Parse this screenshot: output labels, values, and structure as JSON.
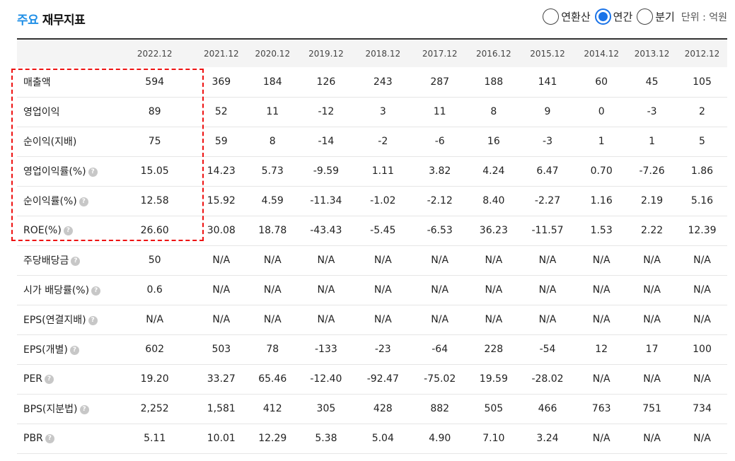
{
  "header": {
    "title_accent": "주요",
    "title_rest": "재무지표",
    "options": [
      "연환산",
      "연간",
      "분기"
    ],
    "selected_option": "연간",
    "unit_label": "단위 : 억원"
  },
  "columns": [
    "2022.12",
    "2021.12",
    "2020.12",
    "2019.12",
    "2018.12",
    "2017.12",
    "2016.12",
    "2015.12",
    "2014.12",
    "2013.12",
    "2012.12"
  ],
  "rows": [
    {
      "label": "매출액",
      "help": false,
      "values": [
        "594",
        "369",
        "184",
        "126",
        "243",
        "287",
        "188",
        "141",
        "60",
        "45",
        "105"
      ]
    },
    {
      "label": "영업이익",
      "help": false,
      "values": [
        "89",
        "52",
        "11",
        "-12",
        "3",
        "11",
        "8",
        "9",
        "0",
        "-3",
        "2"
      ]
    },
    {
      "label": "순이익(지배)",
      "help": false,
      "values": [
        "75",
        "59",
        "8",
        "-14",
        "-2",
        "-6",
        "16",
        "-3",
        "1",
        "1",
        "5"
      ]
    },
    {
      "label": "영업이익률(%)",
      "help": true,
      "values": [
        "15.05",
        "14.23",
        "5.73",
        "-9.59",
        "1.11",
        "3.82",
        "4.24",
        "6.47",
        "0.70",
        "-7.26",
        "1.86"
      ]
    },
    {
      "label": "순이익률(%)",
      "help": true,
      "values": [
        "12.58",
        "15.92",
        "4.59",
        "-11.34",
        "-1.02",
        "-2.12",
        "8.40",
        "-2.27",
        "1.16",
        "2.19",
        "5.16"
      ]
    },
    {
      "label": "ROE(%)",
      "help": true,
      "values": [
        "26.60",
        "30.08",
        "18.78",
        "-43.43",
        "-5.45",
        "-6.53",
        "36.23",
        "-11.57",
        "1.53",
        "2.22",
        "12.39"
      ]
    },
    {
      "label": "주당배당금",
      "help": true,
      "values": [
        "50",
        "N/A",
        "N/A",
        "N/A",
        "N/A",
        "N/A",
        "N/A",
        "N/A",
        "N/A",
        "N/A",
        "N/A"
      ]
    },
    {
      "label": "시가 배당률(%)",
      "help": true,
      "values": [
        "0.6",
        "N/A",
        "N/A",
        "N/A",
        "N/A",
        "N/A",
        "N/A",
        "N/A",
        "N/A",
        "N/A",
        "N/A"
      ]
    },
    {
      "label": "EPS(연결지배)",
      "help": true,
      "values": [
        "N/A",
        "N/A",
        "N/A",
        "N/A",
        "N/A",
        "N/A",
        "N/A",
        "N/A",
        "N/A",
        "N/A",
        "N/A"
      ]
    },
    {
      "label": "EPS(개별)",
      "help": true,
      "values": [
        "602",
        "503",
        "78",
        "-133",
        "-23",
        "-64",
        "228",
        "-54",
        "12",
        "17",
        "100"
      ]
    },
    {
      "label": "PER",
      "help": true,
      "values": [
        "19.20",
        "33.27",
        "65.46",
        "-12.40",
        "-92.47",
        "-75.02",
        "19.59",
        "-28.02",
        "N/A",
        "N/A",
        "N/A"
      ]
    },
    {
      "label": "BPS(지분법)",
      "help": true,
      "values": [
        "2,252",
        "1,581",
        "412",
        "305",
        "428",
        "882",
        "505",
        "466",
        "763",
        "751",
        "734"
      ]
    },
    {
      "label": "PBR",
      "help": true,
      "values": [
        "5.11",
        "10.01",
        "12.29",
        "5.38",
        "5.04",
        "4.90",
        "7.10",
        "3.24",
        "N/A",
        "N/A",
        "N/A"
      ]
    }
  ],
  "help_icon_glyph": "?",
  "colors": {
    "accent": "#1f8ee6",
    "radio": "#1a73e8",
    "highlight": "#e11111"
  }
}
